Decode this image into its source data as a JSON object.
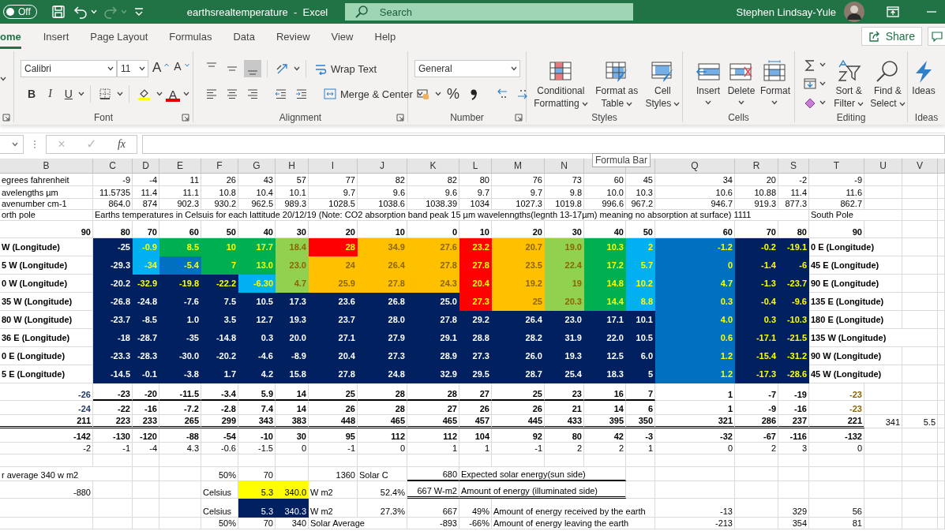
{
  "title_bar": {
    "autosave": {
      "label": "Off",
      "on": false
    },
    "redo": {
      "disabled": true
    },
    "title": "earthsrealtemperature  -  Excel",
    "search": {
      "placeholder": "Search"
    },
    "user": "Stephen Lindsay-Yule"
  },
  "tabs": [
    {
      "label": "ome",
      "selected": true
    },
    {
      "label": "Insert",
      "selected": false
    },
    {
      "label": "Page Layout",
      "selected": false
    },
    {
      "label": "Formulas",
      "selected": false
    },
    {
      "label": "Data",
      "selected": false
    },
    {
      "label": "Review",
      "selected": false
    },
    {
      "label": "View",
      "selected": false
    },
    {
      "label": "Help",
      "selected": false
    }
  ],
  "share": {
    "label": "Share"
  },
  "ribbon": [
    {
      "kind": "clipped"
    },
    {
      "kind": "font",
      "label": "Font",
      "font_name": "Calibri",
      "font_size": "11",
      "grow": "A",
      "shrink": "A",
      "bold": "B",
      "italic": "I",
      "underline": "U",
      "font_color": "A"
    },
    {
      "kind": "alignment",
      "label": "Alignment",
      "vertical": [
        {
          "selected": false
        },
        {
          "selected": false
        },
        {
          "selected": true
        }
      ],
      "wrap": "Wrap Text",
      "merge": "Merge & Center"
    },
    {
      "kind": "number",
      "label": "Number",
      "format": "General",
      "percent": "%"
    },
    {
      "kind": "styles",
      "label": "Styles",
      "buttons": [
        "Conditional Formatting",
        "Format as Table",
        "Cell Styles"
      ]
    },
    {
      "kind": "cells",
      "label": "Cells",
      "buttons": [
        "Insert",
        "Delete",
        "Format"
      ]
    },
    {
      "kind": "editing",
      "label": "Editing",
      "buttons": [
        "Sort & Filter",
        "Find & Select"
      ]
    },
    {
      "kind": "ideas",
      "label": "Ideas",
      "buttons": [
        "Ideas"
      ]
    }
  ],
  "formula_bar": {
    "cancel": {
      "label": "×",
      "disabled": true
    },
    "enter": {
      "label": "✓",
      "disabled": true
    },
    "function": "fx"
  },
  "tooltip": "Formula Bar",
  "sheet": {
    "columns": [
      {
        "label": "B"
      },
      {
        "label": "C"
      },
      {
        "label": "D"
      },
      {
        "label": "E"
      },
      {
        "label": "F"
      },
      {
        "label": "G"
      },
      {
        "label": "H"
      },
      {
        "label": "I"
      },
      {
        "label": "J"
      },
      {
        "label": "K"
      },
      {
        "label": "L"
      },
      {
        "label": "M"
      },
      {
        "label": "N"
      },
      {},
      {},
      {
        "label": "Q"
      },
      {
        "label": "R"
      },
      {
        "label": "S"
      },
      {
        "label": "T"
      },
      {
        "label": "U"
      },
      {
        "label": "V"
      }
    ],
    "rows": [
      {
        "kind": "normal",
        "cells": [
          {
            "text": "egrees fahrenheit",
            "kind": "text"
          },
          "-9",
          "-4",
          "11",
          "26",
          "43",
          "57",
          "77",
          "82",
          "82",
          "80",
          "76",
          "73",
          "60",
          "45",
          "34",
          "20",
          "-2",
          "-9",
          null,
          null
        ]
      },
      {
        "kind": "normal",
        "cells": [
          {
            "text": "avelengths µm",
            "kind": "text"
          },
          "11.5735",
          "11.4",
          "11.1",
          "10.8",
          "10.4",
          "10.1",
          "9.7",
          "9.6",
          "9.6",
          "9.7",
          "9.7",
          "9.8",
          "10.0",
          "10.3",
          "10.6",
          "10.88",
          "11.4",
          "11.6",
          null,
          null
        ]
      },
      {
        "kind": "normal",
        "cells": [
          {
            "text": "avenumber cm-1",
            "kind": "text"
          },
          "864.0",
          "874",
          "902.3",
          "930.2",
          "962.5",
          "989.3",
          "1028.5",
          "1038.6",
          "1038.39",
          "1034",
          "1027.3",
          "1019.8",
          "996.6",
          "967.2",
          "946.7",
          "919.3",
          "877.3",
          "862.7",
          null,
          null
        ]
      },
      {
        "kind": "normal",
        "cells": [
          {
            "text": "orth pole",
            "kind": "text"
          },
          {
            "text": "Earths temperatures in Celsuis for each lattitude 20/12/19 (Note: CO2 absorption band peak 15 µm wavelenngths(legnth 13-17µm) meaning no absorption at surface) 1111",
            "kind": "text"
          },
          null,
          null,
          null,
          null,
          null,
          null,
          null,
          null,
          null,
          null,
          null,
          null,
          null,
          null,
          null,
          null,
          {
            "text": "South Pole",
            "kind": "text"
          },
          null,
          null
        ]
      },
      {
        "kind": "bold",
        "cells": [
          "90",
          "80",
          "70",
          "60",
          "50",
          "40",
          "30",
          "20",
          "10",
          "0",
          "10",
          "20",
          "30",
          "40",
          "50",
          "60",
          "70",
          "80",
          "90",
          null,
          null
        ]
      },
      {
        "kind": "band",
        "color": "#002060",
        "emphasis": true,
        "cells": [
          {
            "text": "W (Longitude)",
            "kind": "text"
          },
          {
            "text": "-25",
            "emphasis": false
          },
          {
            "text": "-0.9",
            "color": "#00b0f0"
          },
          {
            "text": "8.5",
            "color": "#00b050"
          },
          {
            "text": "10",
            "color": "#00b050"
          },
          {
            "text": "17.7",
            "color": "#00b050"
          },
          {
            "text": "18.4",
            "color": "#92d050"
          },
          {
            "text": "28",
            "color": "#ff0000"
          },
          {
            "text": "34.9",
            "color": "#ffc000"
          },
          {
            "text": "27.6",
            "color": "#ffc000"
          },
          {
            "text": "23.2",
            "color": "#ff0000"
          },
          {
            "text": "20.7",
            "color": "#ffc000"
          },
          {
            "text": "19.0",
            "color": "#92d050"
          },
          {
            "text": "10.3",
            "color": "#00b050"
          },
          {
            "text": "2",
            "color": "#00b0f0"
          },
          {
            "text": "-1.2",
            "color": "#0070c0"
          },
          "-0.2",
          "-19.1",
          {
            "text": "0 E (Longitude)",
            "kind": "text"
          },
          null,
          null
        ]
      },
      {
        "kind": "band",
        "color": "#002060",
        "emphasis": true,
        "cells": [
          {
            "text": "5 W (Longitude)",
            "kind": "text"
          },
          {
            "text": "-29.3",
            "emphasis": false
          },
          {
            "text": "-34",
            "color": "#00b0f0"
          },
          {
            "text": "-5.4",
            "color": "#0070c0"
          },
          {
            "text": "7",
            "color": "#00b050"
          },
          {
            "text": "13.0",
            "color": "#00b050"
          },
          {
            "text": "23.0",
            "color": "#92d050"
          },
          {
            "text": "24",
            "color": "#ffc000"
          },
          {
            "text": "26.4",
            "color": "#ffc000"
          },
          {
            "text": "27.8",
            "color": "#ffc000"
          },
          {
            "text": "27.8",
            "color": "#ff0000"
          },
          {
            "text": "23.5",
            "color": "#ffc000"
          },
          {
            "text": "22.4",
            "color": "#92d050"
          },
          {
            "text": "17.2",
            "color": "#00b050"
          },
          {
            "text": "5.7",
            "color": "#00b0f0"
          },
          {
            "text": "0",
            "color": "#0070c0"
          },
          "-1.4",
          "-6",
          {
            "text": "45 E (Longitude)",
            "kind": "text"
          },
          null,
          null
        ]
      },
      {
        "kind": "band",
        "color": "#002060",
        "emphasis": true,
        "cells": [
          {
            "text": "0 W (Longitude)",
            "kind": "text"
          },
          {
            "text": "-20.2",
            "emphasis": false
          },
          "-32.9",
          "-19.8",
          "-22.2",
          {
            "text": "-6.30",
            "color": "#00b0f0"
          },
          {
            "text": "4.7",
            "color": "#92d050"
          },
          {
            "text": "25.9",
            "color": "#ffc000"
          },
          {
            "text": "27.8",
            "color": "#ffc000"
          },
          {
            "text": "24.3",
            "color": "#ffc000"
          },
          {
            "text": "20.4",
            "color": "#ff0000"
          },
          {
            "text": "19.2",
            "color": "#ffc000"
          },
          {
            "text": "19",
            "color": "#92d050"
          },
          {
            "text": "14.8",
            "color": "#00b050"
          },
          {
            "text": "10.2",
            "color": "#00b0f0"
          },
          {
            "text": "4.7",
            "color": "#0070c0"
          },
          "-1.3",
          "-23.7",
          {
            "text": "90 E (Longitude)",
            "kind": "text"
          },
          null,
          null
        ]
      },
      {
        "kind": "band",
        "color": "#002060",
        "emphasis": true,
        "cells": [
          {
            "text": "35 W (Longitude)",
            "kind": "text"
          },
          {
            "text": "-26.8",
            "emphasis": false
          },
          {
            "text": "-24.8",
            "emphasis": false
          },
          {
            "text": "-7.6",
            "emphasis": false
          },
          {
            "text": "7.5",
            "emphasis": false
          },
          {
            "text": "10.5",
            "emphasis": false
          },
          {
            "text": "17.3",
            "emphasis": false
          },
          {
            "text": "23.6",
            "emphasis": false
          },
          {
            "text": "26.8",
            "emphasis": false
          },
          {
            "text": "25.0",
            "emphasis": false
          },
          {
            "text": "27.3",
            "color": "#ff0000"
          },
          {
            "text": "25",
            "color": "#ffc000"
          },
          {
            "text": "20.3",
            "color": "#92d050"
          },
          {
            "text": "14.4",
            "color": "#00b050"
          },
          {
            "text": "8.8",
            "color": "#00b0f0"
          },
          {
            "text": "0.3",
            "color": "#0070c0"
          },
          "-0.4",
          "-9.6",
          {
            "text": "135 E (Longitude)",
            "kind": "text"
          },
          null,
          null
        ]
      },
      {
        "kind": "band",
        "color": "#002060",
        "emphasis": false,
        "cells": [
          {
            "text": "80 W (Longitude)",
            "kind": "text"
          },
          "-23.7",
          "-8.5",
          "1.0",
          "3.5",
          "12.7",
          "19.3",
          "23.7",
          "28.0",
          "27.8",
          "29.2",
          "26.4",
          "23.0",
          "17.1",
          "10.1",
          {
            "text": "4.0",
            "color": "#0070c0",
            "emphasis": true
          },
          {
            "text": "0.3",
            "emphasis": true
          },
          {
            "text": "-10.3",
            "emphasis": true
          },
          {
            "text": "180 E (Longitude)",
            "kind": "text"
          },
          null,
          null
        ]
      },
      {
        "kind": "band",
        "color": "#002060",
        "emphasis": false,
        "cells": [
          {
            "text": "36 E (Longitude)",
            "kind": "text"
          },
          "-18",
          "-28.7",
          "-35",
          "-14.8",
          "0.3",
          "20.0",
          "27.1",
          "27.9",
          "29.1",
          "28.8",
          "28.2",
          "31.9",
          "22.0",
          "10.5",
          {
            "text": "0.6",
            "color": "#0070c0",
            "emphasis": true
          },
          {
            "text": "-17.1",
            "emphasis": true
          },
          {
            "text": "-21.5",
            "emphasis": true
          },
          {
            "text": "135 W (Longitude)",
            "kind": "text"
          },
          null,
          null
        ]
      },
      {
        "kind": "band",
        "color": "#002060",
        "emphasis": false,
        "cells": [
          {
            "text": "0 E (Longitude)",
            "kind": "text"
          },
          "-23.3",
          "-28.3",
          "-30.0",
          "-20.2",
          "-4.6",
          "-8.9",
          "20.4",
          "27.3",
          "28.9",
          "27.3",
          "26.0",
          "19.3",
          "12.5",
          "6.0",
          {
            "text": "1.2",
            "color": "#0070c0",
            "emphasis": true
          },
          {
            "text": "-15.4",
            "emphasis": true
          },
          {
            "text": "-31.2",
            "emphasis": true
          },
          {
            "text": "90 W (Longitude)",
            "kind": "text"
          },
          null,
          null
        ]
      },
      {
        "kind": "band",
        "color": "#002060",
        "emphasis": false,
        "cells": [
          {
            "text": "5 E (Longitude)",
            "kind": "text"
          },
          "-14.5",
          "-0.1",
          "-3.8",
          "1.7",
          "4.2",
          "15.8",
          "27.8",
          "24.8",
          "32.9",
          "29.5",
          "28.7",
          "25.4",
          "18.3",
          "5",
          {
            "text": "1.2",
            "color": "#0070c0",
            "emphasis": true
          },
          {
            "text": "-17.3",
            "emphasis": true
          },
          {
            "text": "-28.6",
            "emphasis": true
          },
          {
            "text": "45 W (Longitude)",
            "kind": "text"
          },
          null,
          null
        ]
      },
      {
        "kind": "bold",
        "cells": [
          {
            "text": "-26",
            "accent": true
          },
          {
            "text": "-23",
            "rule": true
          },
          {
            "text": "-20",
            "rule": true
          },
          {
            "text": "-11.5",
            "rule": true
          },
          {
            "text": "-3.4",
            "rule": true
          },
          {
            "text": "5.9",
            "rule": true
          },
          {
            "text": "14",
            "rule": true
          },
          {
            "text": "25",
            "rule": true
          },
          {
            "text": "28",
            "rule": true
          },
          {
            "text": "28",
            "rule": true
          },
          {
            "text": "27",
            "rule": true
          },
          {
            "text": "25",
            "rule": true
          },
          {
            "text": "23",
            "rule": true
          },
          {
            "text": "16",
            "rule": true
          },
          {
            "text": "7",
            "rule": true
          },
          "1",
          "-7",
          "-19",
          {
            "text": "-23",
            "emphasis": true
          },
          null,
          null
        ]
      },
      {
        "kind": "bold",
        "cells": [
          {
            "text": "-24",
            "accent": true
          },
          "-22",
          "-16",
          "-7.2",
          "-2.8",
          "7.4",
          "14",
          "26",
          "28",
          "27",
          "26",
          "26",
          "21",
          "14",
          "6",
          "1",
          "-9",
          "-16",
          {
            "text": "-23",
            "emphasis": true
          },
          null,
          null
        ]
      },
      {
        "kind": "bold",
        "double_rule": true,
        "cells": [
          "211",
          "223",
          "233",
          "265",
          "299",
          "343",
          "383",
          "448",
          "465",
          "465",
          "457",
          "445",
          "433",
          "395",
          "350",
          "321",
          "286",
          "237",
          "221",
          {
            "text": "341",
            "kind": "plain"
          },
          {
            "text": "5.5",
            "kind": "plain"
          }
        ]
      },
      {
        "kind": "bold",
        "cells": [
          "-142",
          "-130",
          "-120",
          "-88",
          "-54",
          "-10",
          "30",
          "95",
          "112",
          "112",
          "104",
          "92",
          "80",
          "42",
          "-3",
          "-32",
          "-67",
          "-116",
          "-132",
          null,
          null
        ]
      },
      {
        "kind": "normal",
        "cells": [
          "-2",
          "-1",
          "-4",
          "4.3",
          "-0.6",
          "-1.5",
          "0",
          "-1",
          "0",
          "1",
          "1",
          "-1",
          "2",
          "2",
          "1",
          "0",
          "2",
          "3",
          "0",
          null,
          null
        ]
      },
      {
        "kind": "blank"
      },
      {
        "kind": "normal",
        "cells": [
          {
            "text": "r average 340 w m2",
            "kind": "text"
          },
          null,
          null,
          null,
          "50%",
          "70",
          null,
          "1360",
          {
            "text": "Solar C",
            "kind": "text"
          },
          {
            "text": "680",
            "rule": true
          },
          {
            "text": "Expected solar energy(sun side)",
            "kind": "text",
            "rule": true
          },
          null,
          null,
          null,
          null,
          null,
          null,
          null,
          null,
          null,
          null
        ]
      },
      {
        "kind": "normal",
        "cells": [
          "-880",
          null,
          null,
          null,
          {
            "text": "Celsius",
            "kind": "text"
          },
          {
            "text": "5.3",
            "color": "#ffff00"
          },
          {
            "text": "340.0",
            "color": "#ffff00"
          },
          {
            "text": "W m2",
            "kind": "text"
          },
          "52.4%",
          {
            "text": "667 W-m2",
            "double_rule": true
          },
          {
            "text": "Amount of energy (illuminated side)",
            "kind": "text",
            "double_rule": true
          },
          null,
          null,
          null,
          null,
          null,
          null,
          null,
          null,
          null,
          null
        ]
      },
      {
        "kind": "normal",
        "cells": [
          null,
          null,
          null,
          null,
          {
            "text": "Celsius",
            "kind": "text"
          },
          {
            "text": "5.3",
            "color": "#002060"
          },
          {
            "text": "340.3",
            "color": "#002060"
          },
          {
            "text": "W m2",
            "kind": "text"
          },
          "27.3%",
          "667",
          "49%",
          {
            "text": "Amount of energy received by the earth",
            "kind": "text"
          },
          null,
          null,
          null,
          "-13",
          null,
          "329",
          "56",
          null,
          null
        ]
      },
      {
        "kind": "normal",
        "cells": [
          null,
          null,
          null,
          null,
          "50%",
          "70",
          "340",
          {
            "text": "Solar Average",
            "kind": "text"
          },
          null,
          "-893",
          "-66%",
          {
            "text": "Amount of energy leaving the earth",
            "kind": "text"
          },
          null,
          null,
          null,
          "-213",
          null,
          "354",
          "81",
          null,
          null
        ]
      }
    ]
  }
}
